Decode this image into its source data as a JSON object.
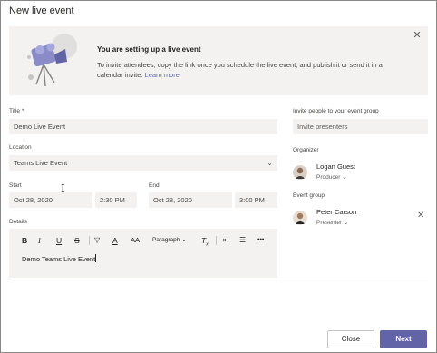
{
  "dialog": {
    "title": "New live event"
  },
  "banner": {
    "heading": "You are setting up a live event",
    "body": "To invite attendees, copy the link once you schedule the live event, and publish it or send it in a calendar invite.",
    "link": "Learn more",
    "close_icon": "close-icon"
  },
  "form": {
    "title_label": "Title *",
    "title_value": "Demo Live Event",
    "location_label": "Location",
    "location_value": "Teams Live Event",
    "start_label": "Start",
    "start_date": "Oct 28, 2020",
    "start_time": "2:30 PM",
    "end_label": "End",
    "end_date": "Oct 28, 2020",
    "end_time": "3:00 PM",
    "details_label": "Details",
    "details_text": "Demo Teams Live Event"
  },
  "toolbar": {
    "bold": "B",
    "italic": "I",
    "underline": "U",
    "strike": "S",
    "font_color": "A",
    "font_size": "A",
    "paragraph": "Paragraph",
    "clear_format": "T",
    "more": "•••",
    "icons": [
      "bold-icon",
      "italic-icon",
      "underline-icon",
      "strikethrough-icon",
      "highlight-icon",
      "font-color-icon",
      "font-size-icon",
      "paragraph-dropdown",
      "clear-formatting-icon",
      "outdent-icon",
      "bullet-list-icon",
      "more-options-icon"
    ]
  },
  "invite": {
    "label": "Invite people to your event group",
    "placeholder": "Invite presenters"
  },
  "organizer": {
    "label": "Organizer",
    "name": "Logan Guest",
    "role": "Producer"
  },
  "event_group": {
    "label": "Event group",
    "name": "Peter Carson",
    "role": "Presenter"
  },
  "buttons": {
    "close": "Close",
    "next": "Next"
  },
  "colors": {
    "accent": "#6264a7",
    "field_bg": "#f3f2f1",
    "banner_bg": "#f3f2f1"
  }
}
